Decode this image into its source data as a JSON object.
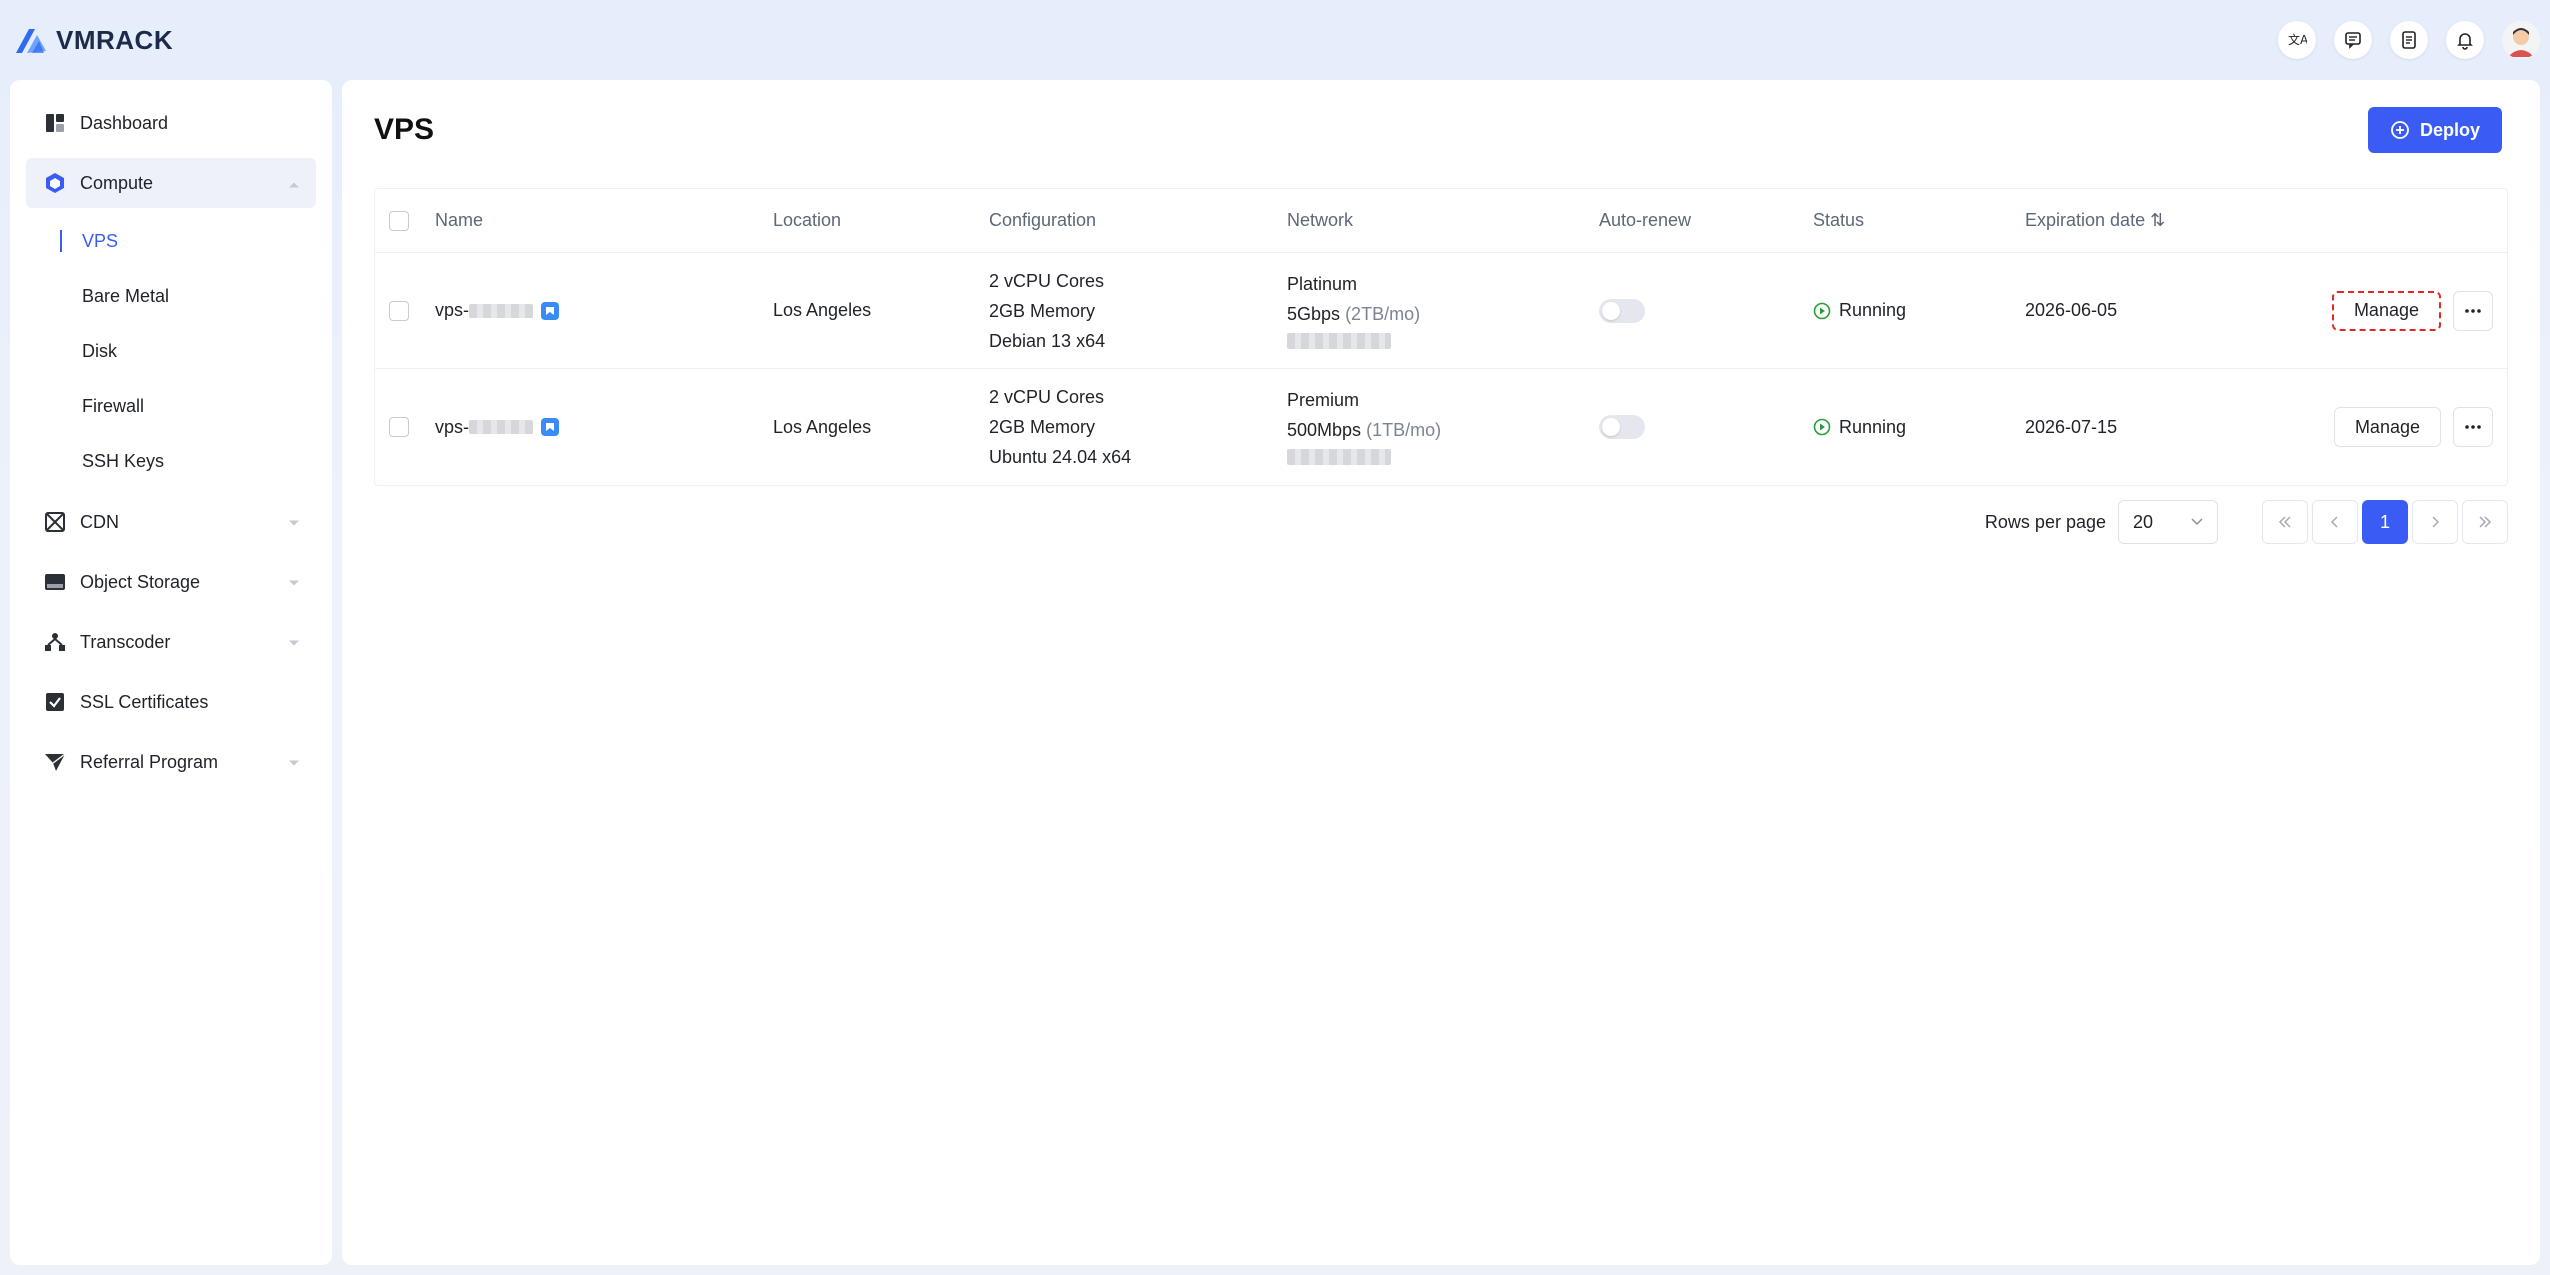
{
  "brand": {
    "name": "VMRACK",
    "accent": "#3a5cf5"
  },
  "topbar": {
    "icons": [
      "translate-icon",
      "chat-icon",
      "document-icon",
      "bell-icon"
    ]
  },
  "sidebar": {
    "items": [
      {
        "label": "Dashboard"
      },
      {
        "label": "Compute",
        "expanded": true,
        "children": [
          {
            "label": "VPS",
            "current": true
          },
          {
            "label": "Bare Metal"
          },
          {
            "label": "Disk"
          },
          {
            "label": "Firewall"
          },
          {
            "label": "SSH Keys"
          }
        ]
      },
      {
        "label": "CDN"
      },
      {
        "label": "Object Storage"
      },
      {
        "label": "Transcoder"
      },
      {
        "label": "SSL Certificates"
      },
      {
        "label": "Referral Program"
      }
    ]
  },
  "page": {
    "title": "VPS",
    "deploy_label": "Deploy"
  },
  "table": {
    "headers": {
      "name": "Name",
      "location": "Location",
      "configuration": "Configuration",
      "network": "Network",
      "auto_renew": "Auto-renew",
      "status": "Status",
      "expiration": "Expiration date ⇅"
    },
    "rows": [
      {
        "name": "vps-",
        "location": "Los Angeles",
        "config": [
          "2 vCPU Cores",
          "2GB Memory",
          "Debian 13 x64"
        ],
        "network_tier": "Platinum",
        "bandwidth": "5Gbps",
        "quota": "(2TB/mo)",
        "auto_renew": false,
        "status": "Running",
        "expiration": "2026-06-05",
        "manage_label": "Manage"
      },
      {
        "name": "vps-",
        "location": "Los Angeles",
        "config": [
          "2 vCPU Cores",
          "2GB Memory",
          "Ubuntu 24.04 x64"
        ],
        "network_tier": "Premium",
        "bandwidth": "500Mbps",
        "quota": "(1TB/mo)",
        "auto_renew": false,
        "status": "Running",
        "expiration": "2026-07-15",
        "manage_label": "Manage"
      }
    ]
  },
  "pagination": {
    "rows_per_page_label": "Rows per page",
    "rows_per_page": "20",
    "current_page": "1"
  }
}
